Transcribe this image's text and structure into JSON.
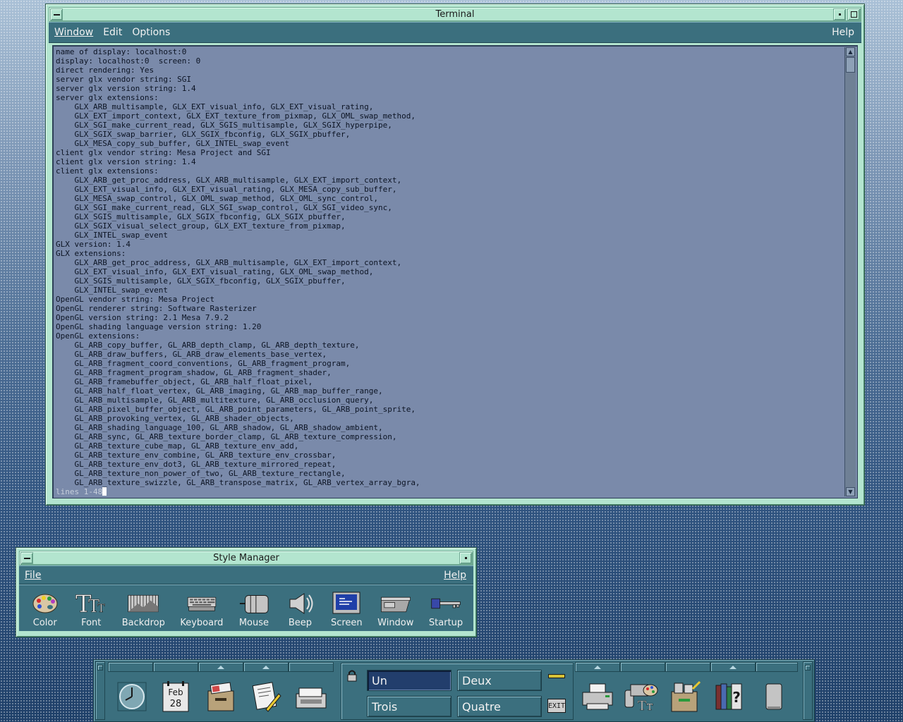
{
  "terminal": {
    "title": "Terminal",
    "menu": {
      "window": "Window",
      "edit": "Edit",
      "options": "Options",
      "help": "Help"
    },
    "lines": [
      "name of display: localhost:0",
      "display: localhost:0  screen: 0",
      "direct rendering: Yes",
      "server glx vendor string: SGI",
      "server glx version string: 1.4",
      "server glx extensions:",
      "    GLX_ARB_multisample, GLX_EXT_visual_info, GLX_EXT_visual_rating,",
      "    GLX_EXT_import_context, GLX_EXT_texture_from_pixmap, GLX_OML_swap_method,",
      "    GLX_SGI_make_current_read, GLX_SGIS_multisample, GLX_SGIX_hyperpipe,",
      "    GLX_SGIX_swap_barrier, GLX_SGIX_fbconfig, GLX_SGIX_pbuffer,",
      "    GLX_MESA_copy_sub_buffer, GLX_INTEL_swap_event",
      "client glx vendor string: Mesa Project and SGI",
      "client glx version string: 1.4",
      "client glx extensions:",
      "    GLX_ARB_get_proc_address, GLX_ARB_multisample, GLX_EXT_import_context,",
      "    GLX_EXT_visual_info, GLX_EXT_visual_rating, GLX_MESA_copy_sub_buffer,",
      "    GLX_MESA_swap_control, GLX_OML_swap_method, GLX_OML_sync_control,",
      "    GLX_SGI_make_current_read, GLX_SGI_swap_control, GLX_SGI_video_sync,",
      "    GLX_SGIS_multisample, GLX_SGIX_fbconfig, GLX_SGIX_pbuffer,",
      "    GLX_SGIX_visual_select_group, GLX_EXT_texture_from_pixmap,",
      "    GLX_INTEL_swap_event",
      "GLX version: 1.4",
      "GLX extensions:",
      "    GLX_ARB_get_proc_address, GLX_ARB_multisample, GLX_EXT_import_context,",
      "    GLX_EXT_visual_info, GLX_EXT_visual_rating, GLX_OML_swap_method,",
      "    GLX_SGIS_multisample, GLX_SGIX_fbconfig, GLX_SGIX_pbuffer,",
      "    GLX_INTEL_swap_event",
      "OpenGL vendor string: Mesa Project",
      "OpenGL renderer string: Software Rasterizer",
      "OpenGL version string: 2.1 Mesa 7.9.2",
      "OpenGL shading language version string: 1.20",
      "OpenGL extensions:",
      "    GL_ARB_copy_buffer, GL_ARB_depth_clamp, GL_ARB_depth_texture,",
      "    GL_ARB_draw_buffers, GL_ARB_draw_elements_base_vertex,",
      "    GL_ARB_fragment_coord_conventions, GL_ARB_fragment_program,",
      "    GL_ARB_fragment_program_shadow, GL_ARB_fragment_shader,",
      "    GL_ARB_framebuffer_object, GL_ARB_half_float_pixel,",
      "    GL_ARB_half_float_vertex, GL_ARB_imaging, GL_ARB_map_buffer_range,",
      "    GL_ARB_multisample, GL_ARB_multitexture, GL_ARB_occlusion_query,",
      "    GL_ARB_pixel_buffer_object, GL_ARB_point_parameters, GL_ARB_point_sprite,",
      "    GL_ARB_provoking_vertex, GL_ARB_shader_objects,",
      "    GL_ARB_shading_language_100, GL_ARB_shadow, GL_ARB_shadow_ambient,",
      "    GL_ARB_sync, GL_ARB_texture_border_clamp, GL_ARB_texture_compression,",
      "    GL_ARB_texture_cube_map, GL_ARB_texture_env_add,",
      "    GL_ARB_texture_env_combine, GL_ARB_texture_env_crossbar,",
      "    GL_ARB_texture_env_dot3, GL_ARB_texture_mirrored_repeat,",
      "    GL_ARB_texture_non_power_of_two, GL_ARB_texture_rectangle,",
      "    GL_ARB_texture_swizzle, GL_ARB_transpose_matrix, GL_ARB_vertex_array_bgra,"
    ],
    "status": "lines 1-48"
  },
  "style_manager": {
    "title": "Style Manager",
    "menu": {
      "file": "File",
      "help": "Help"
    },
    "items": [
      {
        "label": "Color",
        "icon": "palette-icon"
      },
      {
        "label": "Font",
        "icon": "font-icon"
      },
      {
        "label": "Backdrop",
        "icon": "backdrop-icon"
      },
      {
        "label": "Keyboard",
        "icon": "keyboard-icon"
      },
      {
        "label": "Mouse",
        "icon": "mouse-icon"
      },
      {
        "label": "Beep",
        "icon": "speaker-icon"
      },
      {
        "label": "Screen",
        "icon": "monitor-icon"
      },
      {
        "label": "Window",
        "icon": "window-icon"
      },
      {
        "label": "Startup",
        "icon": "key-icon"
      }
    ]
  },
  "front_panel": {
    "calendar": {
      "month": "Feb",
      "day": "28"
    },
    "workspaces": [
      "Un",
      "Deux",
      "Trois",
      "Quatre"
    ],
    "active_workspace": "Un",
    "exit_label": "EXIT",
    "help_glyph": "?"
  },
  "colors": {
    "frame": "#b3e5cf",
    "menubar": "#3b6f7e",
    "terminal_bg": "#7a8aaa",
    "active_workspace": "#223e6c"
  }
}
